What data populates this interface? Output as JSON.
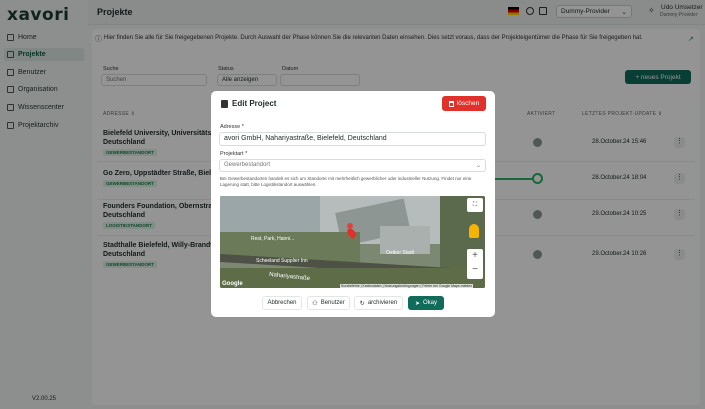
{
  "app": {
    "logo": "xavori",
    "version": "V2.00.25"
  },
  "sidebar": {
    "items": [
      {
        "label": "Home",
        "icon": "home-icon"
      },
      {
        "label": "Projekte",
        "icon": "folder-icon",
        "active": true
      },
      {
        "label": "Benutzer",
        "icon": "users-icon"
      },
      {
        "label": "Organisation",
        "icon": "organisation-icon"
      },
      {
        "label": "Wissenscenter",
        "icon": "knowledge-icon"
      },
      {
        "label": "Projektarchiv",
        "icon": "archive-icon"
      }
    ]
  },
  "header": {
    "title": "Projekte",
    "provider": "Dummy-Provider",
    "user_name": "Udo Umsetzer",
    "user_sub": "Dummy-Provider"
  },
  "main": {
    "info": "Hier finden Sie alle für Sie freigegebenen Projekte. Durch Auswahl der Phase können Sie die relevanten Daten einsehen. Dies setzt voraus, dass der Projekteigentümer die Phase für Sie freigegeben hat.",
    "filters": {
      "search_label": "Suche",
      "search_placeholder": "Suchen",
      "status_label": "Status",
      "status_value": "Alle anzeigen",
      "date_label": "Datum"
    },
    "new_button": "+ neues Projekt",
    "columns": {
      "address": "ADRESSE ⇕",
      "active": "AKTIVIERT",
      "updated": "LETZTES PROJEKT-UPDATE ⇕"
    },
    "rows": [
      {
        "address": "Bielefeld University, Universitätsstraße",
        "city": "Deutschland",
        "badge": "GEWERBESTANDORT",
        "date": "28.October.24 15:46"
      },
      {
        "address": "Go Zero, Uppstädter Straße, Bielefeld,",
        "city": "",
        "badge": "GEWERBESTANDORT",
        "date": "28.October.24 18:04"
      },
      {
        "address": "Founders Foundation, Obernstraße, B",
        "city": "Deutschland",
        "badge": "LOGISTIKSTANDORT",
        "date": "29.October.24 10:25"
      },
      {
        "address": "Stadthalle Bielefeld, Willy-Brandt-Plat",
        "city": "Deutschland",
        "badge": "GEWERBESTANDORT",
        "date": "29.October.24 10:26"
      }
    ]
  },
  "modal": {
    "title": "Edit Project",
    "delete_label": "löschen",
    "address_label": "Adresse *",
    "address_value": "avori GmbH, Nahariyastraße, Bielefeld, Deutschland",
    "type_label": "Projektart *",
    "type_value": "Gewerbestandort",
    "hint": "Bei Gewerbestandorten handelt es sich um Standorte mit mehrheitlich gewerblicher oder industrieller Nutzung. Findet nur eine Lagerung statt, bitte Logistikstandort auswählen.",
    "map_labels": {
      "street1": "Rest, Park, Hanni...",
      "street2": "Nahariyastraße",
      "poi": "Oetker Stadt",
      "store": "Scheeland Supplier Inn",
      "footer": "Kurzbefehle | Kartendaten | Nutzungsbedingungen | Fehler bei Google Maps melden",
      "google": "Google"
    },
    "buttons": {
      "cancel": "Abbrechen",
      "users": "Benutzer",
      "archive": "archivieren",
      "ok": "Okay"
    }
  }
}
